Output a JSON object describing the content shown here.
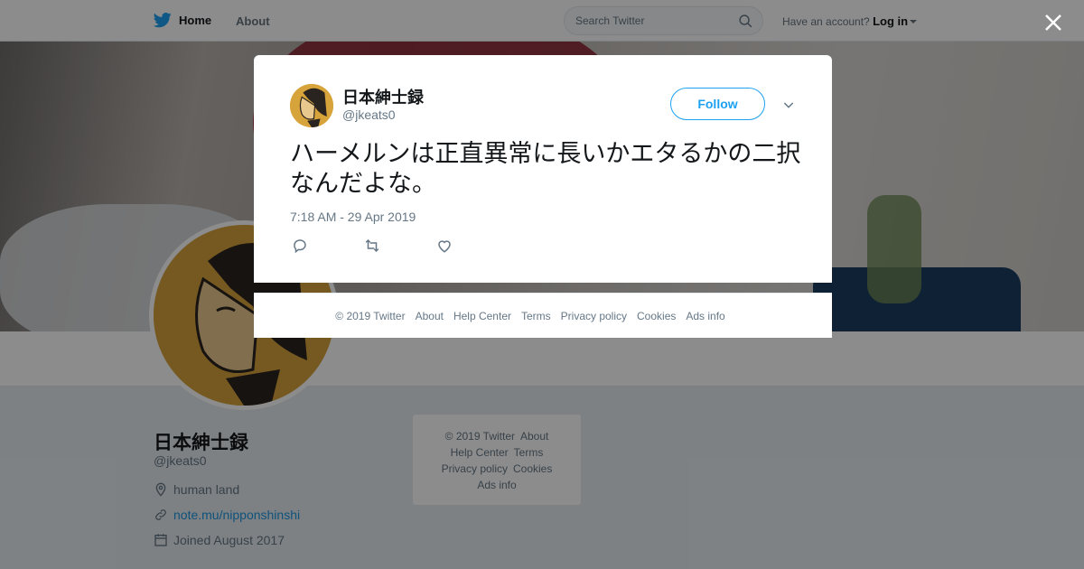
{
  "topbar": {
    "home_label": "Home",
    "about_label": "About",
    "search_placeholder": "Search Twitter",
    "have_account": "Have an account?",
    "login_label": "Log in"
  },
  "profile": {
    "name": "日本紳士録",
    "handle": "@jkeats0",
    "location": "human land",
    "website": "note.mu/nipponshinshi",
    "joined": "Joined August 2017"
  },
  "side_footer": {
    "copyright": "© 2019 Twitter",
    "about": "About",
    "help_center": "Help Center",
    "terms": "Terms",
    "privacy": "Privacy policy",
    "cookies": "Cookies",
    "ads_info": "Ads info"
  },
  "tweet": {
    "name": "日本紳士録",
    "handle": "@jkeats0",
    "follow_label": "Follow",
    "text": "ハーメルンは正直異常に長いかエタるかの二択なんだよな。",
    "timestamp": "7:18 AM - 29 Apr 2019"
  },
  "card_footer": {
    "copyright": "© 2019 Twitter",
    "about": "About",
    "help_center": "Help Center",
    "terms": "Terms",
    "privacy": "Privacy policy",
    "cookies": "Cookies",
    "ads_info": "Ads info"
  },
  "icons": {
    "brand": "twitter-bird-icon",
    "search": "search-icon",
    "close": "close-icon",
    "reply": "reply-icon",
    "retweet": "retweet-icon",
    "like": "heart-icon",
    "location": "location-pin-icon",
    "link": "link-icon",
    "calendar": "calendar-icon"
  },
  "colors": {
    "brand_blue": "#1da1f2",
    "link_blue": "#1b95e0",
    "muted": "#657786"
  }
}
